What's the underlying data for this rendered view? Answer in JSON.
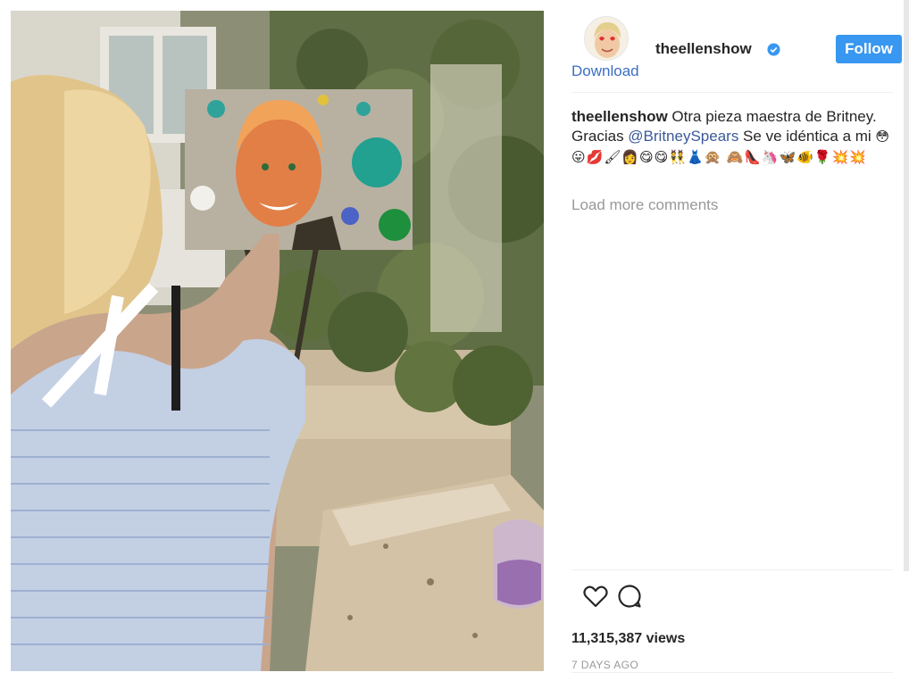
{
  "post": {
    "username": "theellenshow",
    "follow_label": "Follow",
    "download_label": "Download",
    "caption": {
      "username": "theellenshow",
      "text_before": "Otra pieza maestra de Britney. Gracias ",
      "mention": "@BritneySpears",
      "text_after": " Se ve idéntica a mi ",
      "emojis": "😳😛💋🖌👩😋😋👯👗🙊 🙈👠🦄🦋🐠🌹💥💥"
    },
    "load_more_label": "Load more comments",
    "views": "11,315,387 views",
    "time_ago": "7 DAYS AGO"
  },
  "icons": {
    "like": "heart-icon",
    "comment": "comment-icon",
    "verified": "verified-badge-icon"
  },
  "colors": {
    "follow_button": "#3897f0",
    "link": "#3b6fc4",
    "mention": "#3b5998",
    "muted": "#999999"
  }
}
